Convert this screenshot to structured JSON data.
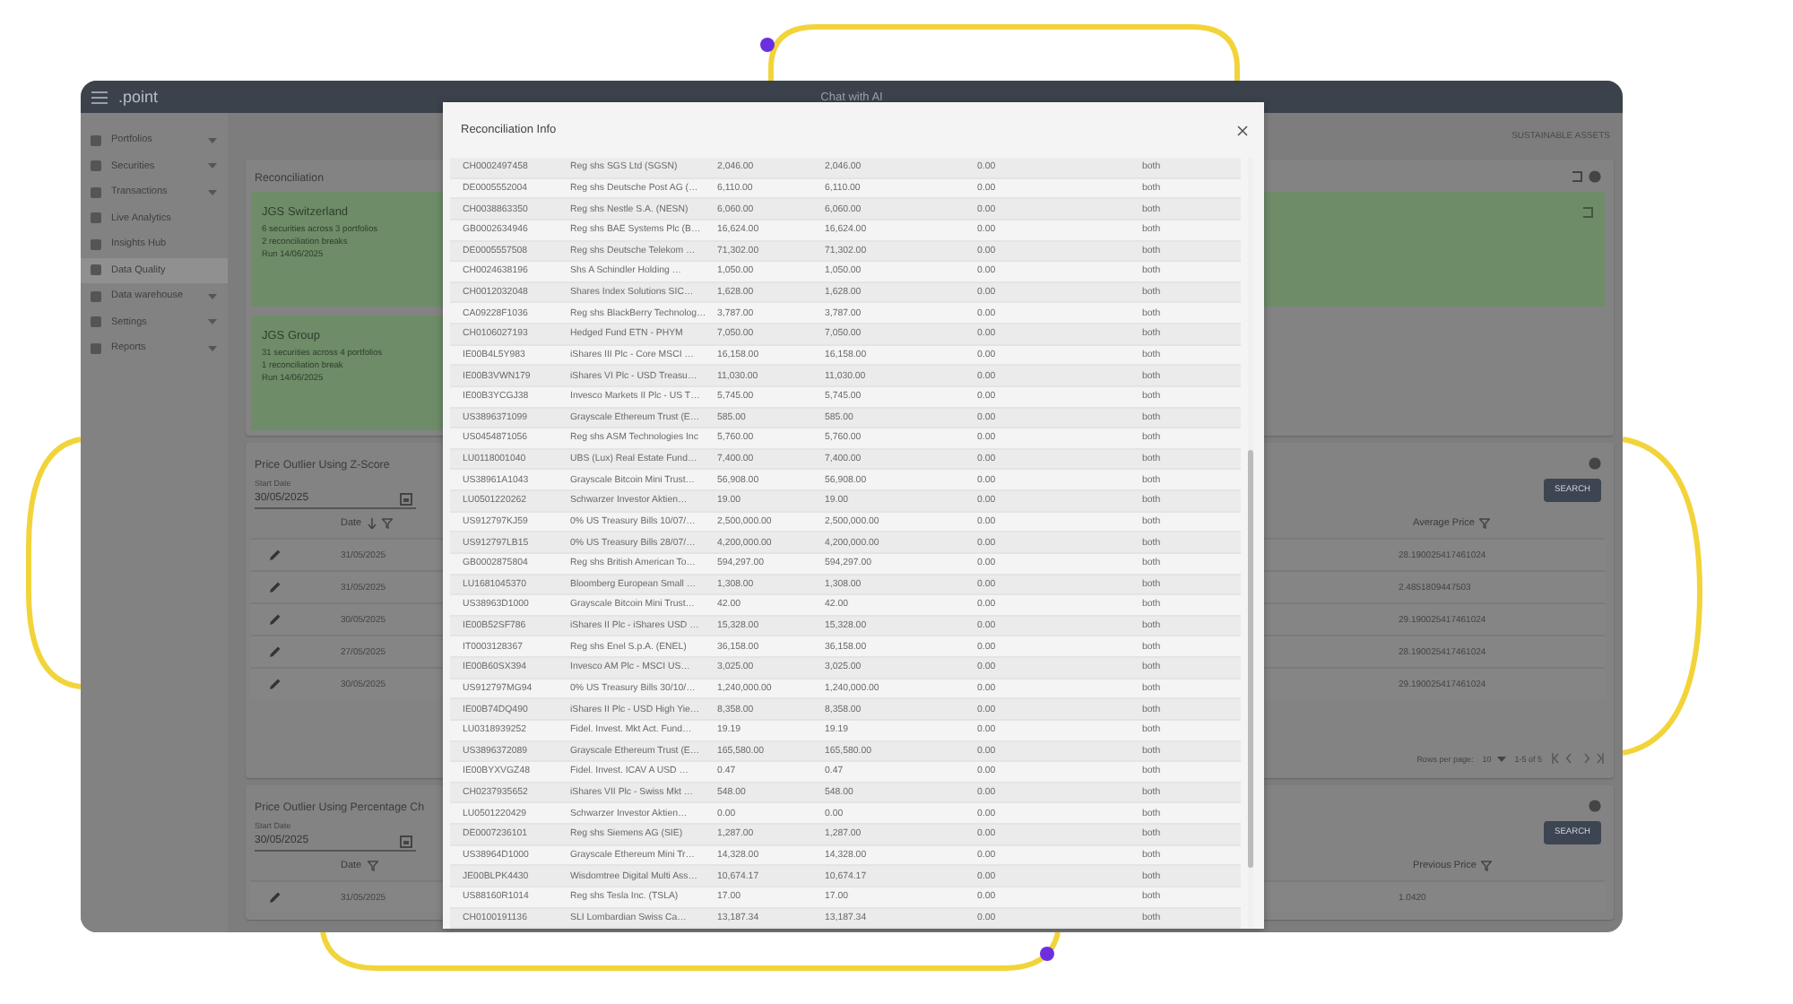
{
  "topbar": {
    "logo": ".point",
    "title": "Chat with AI"
  },
  "sidebar": {
    "items": [
      {
        "label": "Portfolios",
        "selected": false,
        "expandable": true
      },
      {
        "label": "Securities",
        "selected": false,
        "expandable": true
      },
      {
        "label": "Transactions",
        "selected": false,
        "expandable": true
      },
      {
        "label": "Live Analytics",
        "selected": false,
        "expandable": false
      },
      {
        "label": "Insights Hub",
        "selected": false,
        "expandable": false
      },
      {
        "label": "Data Quality",
        "selected": true,
        "expandable": false
      },
      {
        "label": "Data warehouse",
        "selected": false,
        "expandable": true
      },
      {
        "label": "Settings",
        "selected": false,
        "expandable": true
      },
      {
        "label": "Reports",
        "selected": false,
        "expandable": true
      }
    ]
  },
  "header_link": "SUSTAINABLE ASSETS",
  "reconciliation": {
    "title": "Reconciliation",
    "cards": [
      {
        "title": "JGS Switzerland",
        "lines": [
          "6 securities across 3 portfolios",
          "2 reconciliation breaks",
          "Run 14/06/2025"
        ]
      },
      {
        "title": "JGS Group",
        "lines": [
          "31 securities across 4 portfolios",
          "1 reconciliation break",
          "Run 14/06/2025"
        ]
      }
    ]
  },
  "zscore": {
    "title": "Price Outlier Using Z-Score",
    "date_label": "Start Date",
    "date_value": "30/05/2025",
    "search": "SEARCH",
    "columns": [
      "Date",
      "Average Price"
    ],
    "rows": [
      {
        "date": "31/05/2025",
        "value": "28.190025417461024"
      },
      {
        "date": "31/05/2025",
        "value": "2.4851809447503"
      },
      {
        "date": "30/05/2025",
        "value": "29.190025417461024"
      },
      {
        "date": "27/05/2025",
        "value": "28.190025417461024"
      },
      {
        "date": "30/05/2025",
        "value": "29.190025417461024"
      }
    ],
    "pagination": {
      "rows_label": "Rows per page:",
      "rows_value": "10",
      "range": "1-5 of 5"
    }
  },
  "percent": {
    "title": "Price Outlier Using Percentage Ch",
    "date_label": "Start Date",
    "date_value": "30/05/2025",
    "search": "SEARCH",
    "columns": [
      "Date",
      "Previous Price"
    ],
    "rows": [
      {
        "date": "31/05/2025",
        "value": "1.0420"
      }
    ]
  },
  "modal": {
    "title": "Reconciliation Info",
    "rows": [
      [
        "CH0002497458",
        "Reg shs SGS Ltd (SGSN)",
        "2,046.00",
        "2,046.00",
        "0.00",
        "both"
      ],
      [
        "DE0005552004",
        "Reg shs Deutsche Post AG (…",
        "6,110.00",
        "6,110.00",
        "0.00",
        "both"
      ],
      [
        "CH0038863350",
        "Reg shs Nestle S.A. (NESN)",
        "6,060.00",
        "6,060.00",
        "0.00",
        "both"
      ],
      [
        "GB0002634946",
        "Reg shs BAE Systems Plc (B…",
        "16,624.00",
        "16,624.00",
        "0.00",
        "both"
      ],
      [
        "DE0005557508",
        "Reg shs Deutsche Telekom …",
        "71,302.00",
        "71,302.00",
        "0.00",
        "both"
      ],
      [
        "CH0024638196",
        "Shs A Schindler Holding …",
        "1,050.00",
        "1,050.00",
        "0.00",
        "both"
      ],
      [
        "CH0012032048",
        "Shares Index Solutions SIC…",
        "1,628.00",
        "1,628.00",
        "0.00",
        "both"
      ],
      [
        "CA09228F1036",
        "Reg shs BlackBerry Technolog…",
        "3,787.00",
        "3,787.00",
        "0.00",
        "both"
      ],
      [
        "CH0106027193",
        "Hedged Fund ETN - PHYM",
        "7,050.00",
        "7,050.00",
        "0.00",
        "both"
      ],
      [
        "IE00B4L5Y983",
        "iShares III Plc - Core MSCI …",
        "16,158.00",
        "16,158.00",
        "0.00",
        "both"
      ],
      [
        "IE00B3VWN179",
        "iShares VI Plc - USD Treasu…",
        "11,030.00",
        "11,030.00",
        "0.00",
        "both"
      ],
      [
        "IE00B3YCGJ38",
        "Invesco Markets II Plc - US T…",
        "5,745.00",
        "5,745.00",
        "0.00",
        "both"
      ],
      [
        "US3896371099",
        "Grayscale Ethereum Trust (E…",
        "585.00",
        "585.00",
        "0.00",
        "both"
      ],
      [
        "US0454871056",
        "Reg shs ASM Technologies Inc",
        "5,760.00",
        "5,760.00",
        "0.00",
        "both"
      ],
      [
        "LU0118001040",
        "UBS (Lux) Real Estate Fund…",
        "7,400.00",
        "7,400.00",
        "0.00",
        "both"
      ],
      [
        "US38961A1043",
        "Grayscale Bitcoin Mini Trust…",
        "56,908.00",
        "56,908.00",
        "0.00",
        "both"
      ],
      [
        "LU0501220262",
        "Schwarzer Investor Aktien…",
        "19.00",
        "19.00",
        "0.00",
        "both"
      ],
      [
        "US912797KJ59",
        "0% US Treasury Bills 10/07/…",
        "2,500,000.00",
        "2,500,000.00",
        "0.00",
        "both"
      ],
      [
        "US912797LB15",
        "0% US Treasury Bills 28/07/…",
        "4,200,000.00",
        "4,200,000.00",
        "0.00",
        "both"
      ],
      [
        "GB0002875804",
        "Reg shs British American To…",
        "594,297.00",
        "594,297.00",
        "0.00",
        "both"
      ],
      [
        "LU1681045370",
        "Bloomberg European Small …",
        "1,308.00",
        "1,308.00",
        "0.00",
        "both"
      ],
      [
        "US38963D1000",
        "Grayscale Bitcoin Mini Trust…",
        "42.00",
        "42.00",
        "0.00",
        "both"
      ],
      [
        "IE00B52SF786",
        "iShares II Plc - iShares USD …",
        "15,328.00",
        "15,328.00",
        "0.00",
        "both"
      ],
      [
        "IT0003128367",
        "Reg shs Enel S.p.A. (ENEL)",
        "36,158.00",
        "36,158.00",
        "0.00",
        "both"
      ],
      [
        "IE00B60SX394",
        "Invesco AM Plc - MSCI US…",
        "3,025.00",
        "3,025.00",
        "0.00",
        "both"
      ],
      [
        "US912797MG94",
        "0% US Treasury Bills 30/10/…",
        "1,240,000.00",
        "1,240,000.00",
        "0.00",
        "both"
      ],
      [
        "IE00B74DQ490",
        "iShares II Plc - USD High Yie…",
        "8,358.00",
        "8,358.00",
        "0.00",
        "both"
      ],
      [
        "LU0318939252",
        "Fidel. Invest. Mkt Act. Fund…",
        "19.19",
        "19.19",
        "0.00",
        "both"
      ],
      [
        "US3896372089",
        "Grayscale Ethereum Trust (E…",
        "165,580.00",
        "165,580.00",
        "0.00",
        "both"
      ],
      [
        "IE00BYXVGZ48",
        "Fidel. Invest. ICAV A USD …",
        "0.47",
        "0.47",
        "0.00",
        "both"
      ],
      [
        "CH0237935652",
        "iShares VII Plc - Swiss Mkt …",
        "548.00",
        "548.00",
        "0.00",
        "both"
      ],
      [
        "LU0501220429",
        "Schwarzer Investor Aktien…",
        "0.00",
        "0.00",
        "0.00",
        "both"
      ],
      [
        "DE0007236101",
        "Reg shs Siemens AG (SIE)",
        "1,287.00",
        "1,287.00",
        "0.00",
        "both"
      ],
      [
        "US38964D1000",
        "Grayscale Ethereum Mini Tr…",
        "14,328.00",
        "14,328.00",
        "0.00",
        "both"
      ],
      [
        "JE00BLPK4430",
        "Wisdomtree Digital Multi Ass…",
        "10,674.17",
        "10,674.17",
        "0.00",
        "both"
      ],
      [
        "US88160R1014",
        "Reg shs Tesla Inc. (TSLA)",
        "17.00",
        "17.00",
        "0.00",
        "both"
      ],
      [
        "CH0100191136",
        "SLI Lombardian Swiss Ca…",
        "13,187.34",
        "13,187.34",
        "0.00",
        "both"
      ]
    ]
  }
}
